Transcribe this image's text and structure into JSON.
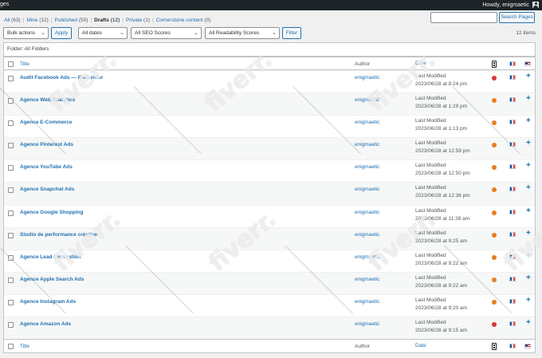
{
  "admin_bar": {
    "site_label": "ges",
    "greeting": "Howdy, enigmaetic"
  },
  "filters_links": {
    "all": "All",
    "all_count": "(63)",
    "mine": "Mine",
    "mine_count": "(12)",
    "published": "Published",
    "published_count": "(50)",
    "drafts": "Drafts",
    "drafts_count": "(12)",
    "private": "Private",
    "private_count": "(1)",
    "cornerstone": "Cornerstone content",
    "cornerstone_count": "(0)"
  },
  "search": {
    "button_label": "Search Pages",
    "value": ""
  },
  "toolbar": {
    "bulk_actions": "Bulk actions",
    "apply": "Apply",
    "all_dates": "All dates",
    "seo_scores": "All SEO Scores",
    "readability_scores": "All Readability Scores",
    "filter": "Filter",
    "items_count": "12 items"
  },
  "folder_label": "Folder: All Folders",
  "table": {
    "columns": {
      "title": "Title",
      "author": "Author",
      "date": "Date"
    },
    "rows": [
      {
        "title": "Audit Facebook Ads — Elementor",
        "author": "enigmaetic",
        "status": "Last Modified",
        "date": "2023/06/28 at 8:24 pm",
        "seo_color": "#d63638"
      },
      {
        "title": "Agence Web Analytics",
        "author": "enigmaetic",
        "status": "Last Modified",
        "date": "2023/06/28 at 1:29 pm",
        "seo_color": "#e67e22"
      },
      {
        "title": "Agence E-Commerce",
        "author": "enigmaetic",
        "status": "Last Modified",
        "date": "2023/06/28 at 1:13 pm",
        "seo_color": "#e67e22"
      },
      {
        "title": "Agence Pinterest Ads",
        "author": "enigmaetic",
        "status": "Last Modified",
        "date": "2023/06/28 at 12:59 pm",
        "seo_color": "#e67e22"
      },
      {
        "title": "Agence YouTube Ads",
        "author": "enigmaetic",
        "status": "Last Modified",
        "date": "2023/06/28 at 12:50 pm",
        "seo_color": "#e67e22"
      },
      {
        "title": "Agence Snapchat Ads",
        "author": "enigmaetic",
        "status": "Last Modified",
        "date": "2023/06/28 at 12:36 pm",
        "seo_color": "#e67e22"
      },
      {
        "title": "Agence Google Shopping",
        "author": "enigmaetic",
        "status": "Last Modified",
        "date": "2023/06/28 at 11:39 am",
        "seo_color": "#e67e22"
      },
      {
        "title": "Studio de performance créative",
        "author": "enigmaetic",
        "status": "Last Modified",
        "date": "2023/06/28 at 9:25 am",
        "seo_color": "#e67e22"
      },
      {
        "title": "Agence Lead Generation",
        "author": "enigmaetic",
        "status": "Last Modified",
        "date": "2023/06/28 at 9:22 am",
        "seo_color": "#e67e22"
      },
      {
        "title": "Agence Apple Search Ads",
        "author": "enigmaetic",
        "status": "Last Modified",
        "date": "2023/06/28 at 9:22 am",
        "seo_color": "#e67e22"
      },
      {
        "title": "Agence Instagram Ads",
        "author": "enigmaetic",
        "status": "Last Modified",
        "date": "2023/06/28 at 9:20 am",
        "seo_color": "#e67e22"
      },
      {
        "title": "Agence Amazon Ads",
        "author": "enigmaetic",
        "status": "Last Modified",
        "date": "2023/06/28 at 9:15 am",
        "seo_color": "#d63638"
      }
    ]
  },
  "watermark": "fiverr.",
  "icons": {
    "seo_column": "seo-score-icon",
    "flag_fr": "flag-fr-icon",
    "flag_us": "flag-us-icon",
    "add_translation": "plus-icon",
    "user_avatar": "avatar-icon"
  },
  "colors": {
    "link": "#2271b1",
    "admin_bar": "#1d2327",
    "seo_bad": "#d63638",
    "seo_ok": "#e67e22"
  }
}
